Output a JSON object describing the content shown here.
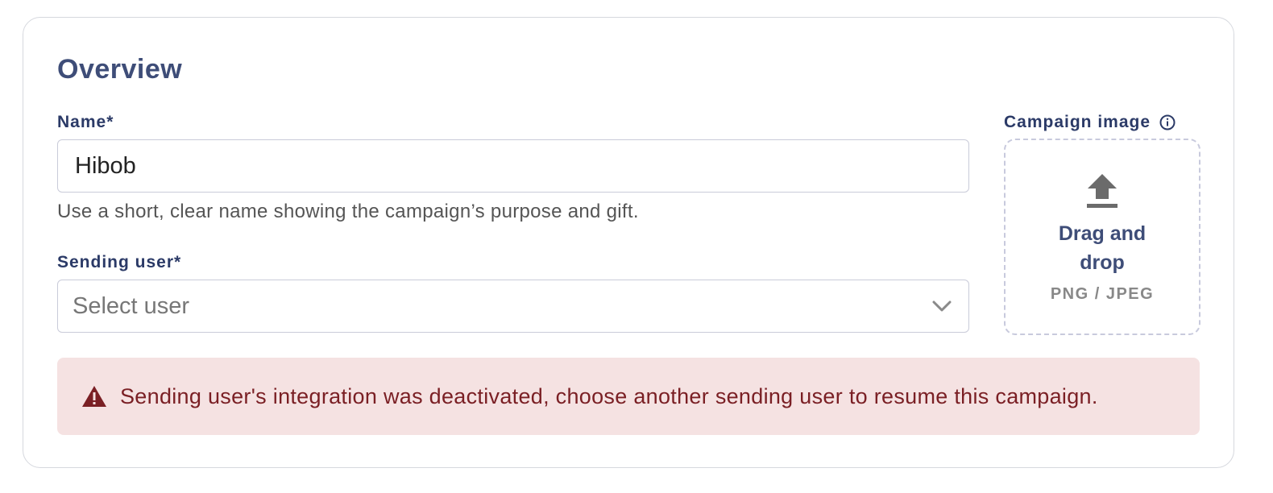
{
  "overview": {
    "title": "Overview"
  },
  "name_field": {
    "label": "Name*",
    "value": "Hibob",
    "helper": "Use a short, clear name showing the campaign’s purpose and gift."
  },
  "sending_user_field": {
    "label": "Sending user*",
    "selected": "Select user",
    "icon": "chevron-down-icon"
  },
  "campaign_image": {
    "label": "Campaign image",
    "info_icon": "info-icon",
    "dropzone_icon": "upload-icon",
    "dropzone_title": "Drag and drop",
    "dropzone_formats": "PNG / JPEG"
  },
  "alert": {
    "icon": "warning-icon",
    "message": "Sending user's integration was deactivated, choose another sending user to resume this campaign."
  },
  "colors": {
    "heading": "#3e4d78",
    "label": "#2b3a67",
    "alert_bg": "#f5e2e2",
    "alert_text": "#7a1f24",
    "border": "#c9cbd9"
  }
}
